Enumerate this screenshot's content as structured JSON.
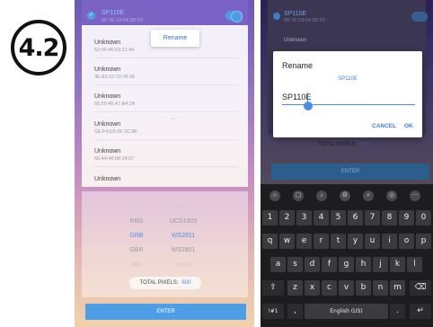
{
  "badge": {
    "label": "4.2"
  },
  "left_screen": {
    "selected_device": {
      "name": "SP110E",
      "mac": "86:7E:19:04:2B:F0"
    },
    "popup": {
      "label": "Rename"
    },
    "devices": [
      {
        "name": "Unknown",
        "mac": "52:06:46:03:21:44"
      },
      {
        "name": "Unknown",
        "mac": "3E:82:02:70:78:08"
      },
      {
        "name": "Unknown",
        "mac": "55:55:45:47:B4:24"
      },
      {
        "name": "Unknown",
        "mac": "SE:F4:D6:0F:3C:8F"
      },
      {
        "name": "Unknown",
        "mac": "56:44:40:08:24:07"
      },
      {
        "name": "Unknown",
        "mac": ""
      }
    ],
    "chip_picker": {
      "order_column": [
        "RGB",
        "RBG",
        "GRB",
        "GBR",
        "BRG"
      ],
      "chip_column": [
        "TM1809",
        "UCS1903",
        "WS2811",
        "WS2801",
        "SK6812"
      ],
      "selected_index": 2
    },
    "total_pixels": {
      "label": "TOTAL PIXELS:",
      "value": "600"
    },
    "enter_label": "ENTER",
    "colors": {
      "accent": "#4e9ee6",
      "selected": "#4e8fe0"
    }
  },
  "right_screen": {
    "selected_device": {
      "name": "SP110E",
      "mac": "86:7E:19:04:2B:F0"
    },
    "background_item": "Unknown",
    "dialog": {
      "title": "Rename",
      "subtitle": "SP110E",
      "input_value": "SP110E",
      "cancel_label": "CANCEL",
      "ok_label": "OK"
    },
    "total_pixels": {
      "label": "TOTAL PIXELS:",
      "value": "600"
    },
    "enter_label": "ENTER",
    "keyboard": {
      "toolbar": [
        "emoji-icon",
        "sticker-icon",
        "mic-icon",
        "settings-icon",
        "search-icon",
        "gif-icon",
        "more-icon"
      ],
      "numbers": [
        "1",
        "2",
        "3",
        "4",
        "5",
        "6",
        "7",
        "8",
        "9",
        "0"
      ],
      "row1": [
        "q",
        "w",
        "e",
        "r",
        "t",
        "y",
        "u",
        "i",
        "o",
        "p"
      ],
      "row2": [
        "a",
        "s",
        "d",
        "f",
        "g",
        "h",
        "j",
        "k",
        "l"
      ],
      "row3": [
        "z",
        "x",
        "c",
        "v",
        "b",
        "n",
        "m"
      ],
      "symbols_label": "!#1",
      "comma": ",",
      "space_label": "English (US)",
      "period": "."
    }
  }
}
